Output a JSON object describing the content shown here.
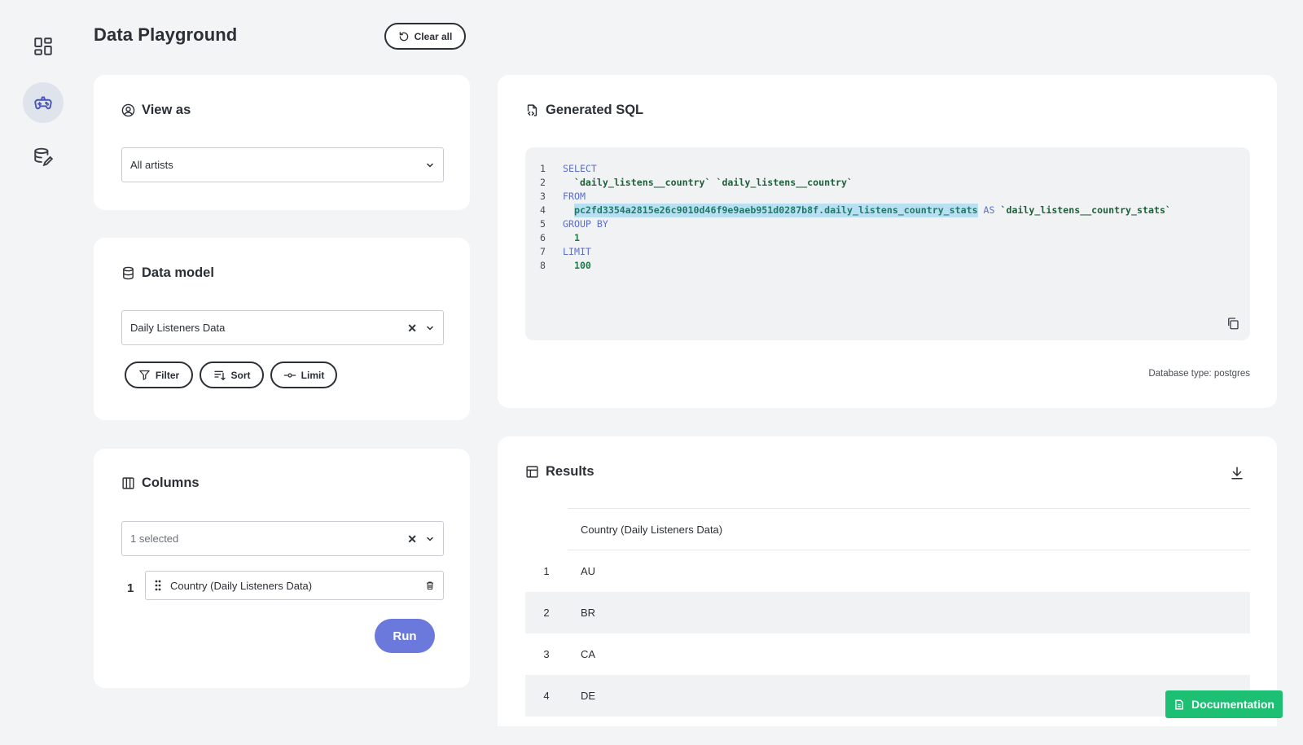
{
  "page": {
    "title": "Data Playground",
    "clear_all_label": "Clear all"
  },
  "sidebar": {
    "items": [
      {
        "name": "dashboard-icon"
      },
      {
        "name": "gamepad-icon",
        "active": true
      },
      {
        "name": "database-edit-icon"
      }
    ]
  },
  "view_as": {
    "title": "View as",
    "selected": "All artists"
  },
  "data_model": {
    "title": "Data model",
    "selected": "Daily Listeners Data",
    "filter_label": "Filter",
    "sort_label": "Sort",
    "limit_label": "Limit"
  },
  "columns": {
    "title": "Columns",
    "selected_text": "1 selected",
    "items": [
      {
        "index": "1",
        "name": "Country (Daily Listeners Data)"
      }
    ],
    "run_label": "Run"
  },
  "sql": {
    "title": "Generated SQL",
    "line_numbers": [
      "1",
      "2",
      "3",
      "4",
      "5",
      "6",
      "7",
      "8"
    ],
    "kw_select": "SELECT",
    "line2": "`daily_listens__country` `daily_listens__country`",
    "kw_from": "FROM",
    "line4_table": "pc2fd3354a2815e26c9010d46f9e9aeb951d0287b8f.daily_listens_country_stats",
    "kw_as": "AS",
    "line4_alias": "`daily_listens__country_stats`",
    "kw_group_by": "GROUP BY",
    "line6": "1",
    "kw_limit": "LIMIT",
    "line8": "100",
    "db_type": "Database type: postgres"
  },
  "results": {
    "title": "Results",
    "column_header": "Country (Daily Listeners Data)",
    "rows": [
      {
        "index": "1",
        "value": "AU"
      },
      {
        "index": "2",
        "value": "BR"
      },
      {
        "index": "3",
        "value": "CA"
      },
      {
        "index": "4",
        "value": "DE"
      }
    ]
  },
  "documentation_label": "Documentation",
  "colors": {
    "accent": "#6b79dc",
    "documentation": "#1dbf73",
    "sidebar_active_bg": "#dfe3ec"
  }
}
